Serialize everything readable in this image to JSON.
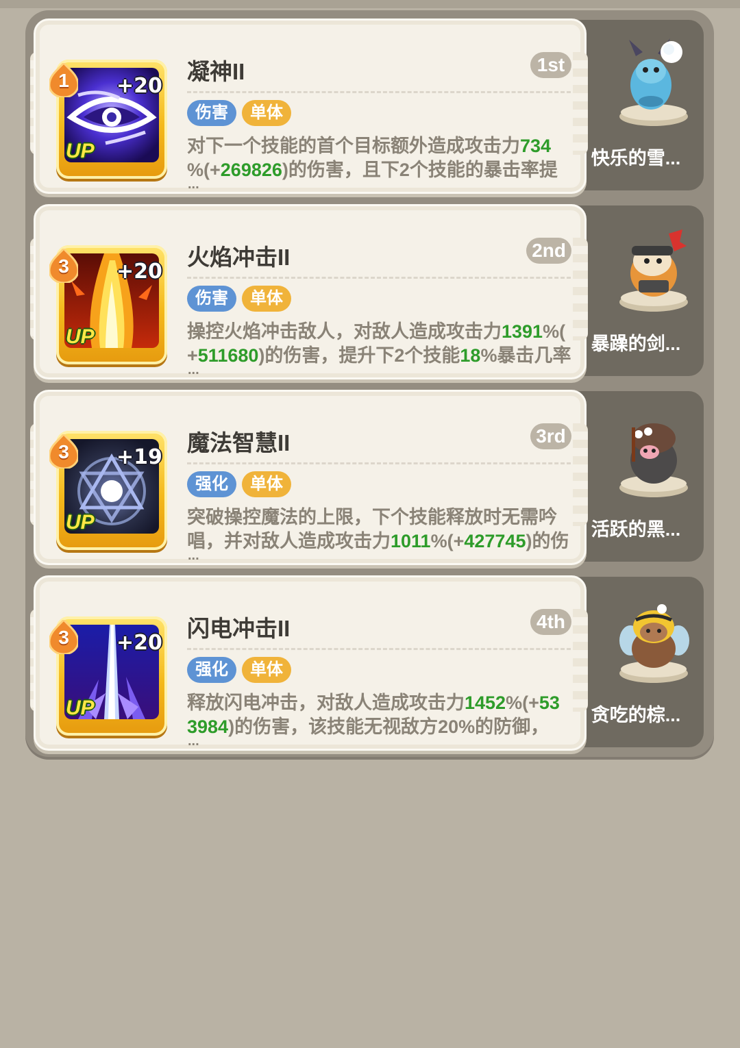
{
  "skills": [
    {
      "name": "凝神II",
      "rank": "1st",
      "level": "1",
      "plus": "+20",
      "up_label": "UP",
      "tags": [
        "伤害",
        "单体"
      ],
      "desc_line1": [
        "对下一个技能的首个目标额外造成攻击力",
        "734"
      ],
      "desc_line2": [
        "%(+",
        "269826",
        ")的伤害，且下2个技能的暴击率提"
      ],
      "ellipsis": "...",
      "pet_name": "快乐的雪...",
      "icon": "eye-of-storm-icon",
      "pet_icon": "snow-rabbit-pet-icon"
    },
    {
      "name": "火焰冲击II",
      "rank": "2nd",
      "level": "3",
      "plus": "+20",
      "up_label": "UP",
      "tags": [
        "伤害",
        "单体"
      ],
      "desc_line1": [
        "操控火焰冲击敌人，对敌人造成攻击力",
        "1391",
        "%("
      ],
      "desc_line2": [
        "+",
        "511680",
        ")的伤害，提升下2个技能",
        "18",
        "%暴击几率"
      ],
      "ellipsis": "...",
      "pet_name": "暴躁的剑...",
      "icon": "fire-blast-icon",
      "pet_icon": "swordsman-hamster-pet-icon"
    },
    {
      "name": "魔法智慧II",
      "rank": "3rd",
      "level": "3",
      "plus": "+19",
      "up_label": "UP",
      "tags": [
        "强化",
        "单体"
      ],
      "desc_line1": [
        "突破操控魔法的上限，下个技能释放时无需吟"
      ],
      "desc_line2": [
        "唱，并对敌人造成攻击力",
        "1011",
        "%(+",
        "427745",
        ")的伤"
      ],
      "ellipsis": "...",
      "pet_name": "活跃的黑...",
      "icon": "magic-hexagram-icon",
      "pet_icon": "black-pig-pet-icon"
    },
    {
      "name": "闪电冲击II",
      "rank": "4th",
      "level": "3",
      "plus": "+20",
      "up_label": "UP",
      "tags": [
        "强化",
        "单体"
      ],
      "desc_line1": [
        "释放闪电冲击，对敌人造成攻击力",
        "1452",
        "%(+",
        "53"
      ],
      "desc_line2": [
        "3984",
        ")的伤害，该技能无视敌方20%的防御，"
      ],
      "ellipsis": "...",
      "pet_name": "贪吃的棕...",
      "icon": "lightning-strike-icon",
      "pet_icon": "bee-bear-pet-icon"
    }
  ],
  "colors": {
    "background": "#b9b2a4",
    "panel": "#948d81",
    "card": "#f5f1e8",
    "highlight_number": "#2e9c2a",
    "tag_blue": "#5e93d4",
    "tag_gold": "#f0b33a"
  }
}
